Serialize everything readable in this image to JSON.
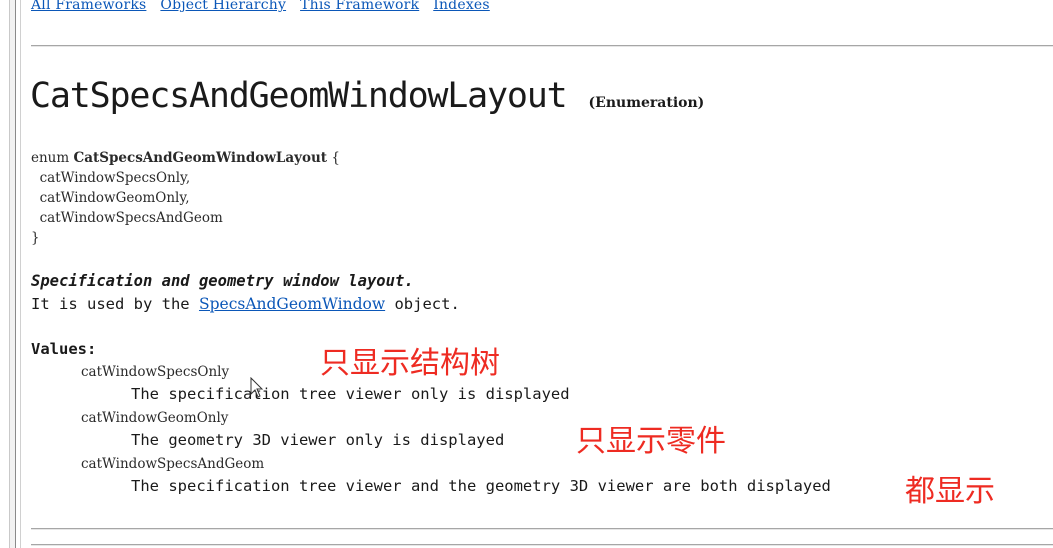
{
  "nav": {
    "links": [
      "All Frameworks",
      "Object Hierarchy",
      "This Framework",
      "Indexes"
    ]
  },
  "header": {
    "title": "CatSpecsAndGeomWindowLayout",
    "subtitle": "(Enumeration)"
  },
  "code": {
    "enum_keyword": "enum ",
    "enum_name": "CatSpecsAndGeomWindowLayout",
    "open_brace": " {",
    "lines": [
      "  catWindowSpecsOnly,",
      "  catWindowGeomOnly,",
      "  catWindowSpecsAndGeom"
    ],
    "close_brace": "}"
  },
  "description": {
    "headline": "Specification and geometry window layout.",
    "usage_prefix": "It is used by the ",
    "usage_link": "SpecsAndGeomWindow",
    "usage_suffix": " object."
  },
  "values": {
    "heading": "Values:",
    "items": [
      {
        "name": "catWindowSpecsOnly",
        "description": "The specification tree viewer only is displayed"
      },
      {
        "name": "catWindowGeomOnly",
        "description": "The geometry 3D viewer only is displayed"
      },
      {
        "name": "catWindowSpecsAndGeom",
        "description": "The specification tree viewer and the geometry 3D viewer are both displayed"
      }
    ]
  },
  "annotations": [
    "只显示结构树",
    "只显示零件",
    "都显示"
  ],
  "colors": {
    "link": "#0b57b8",
    "annotation": "#ee2b22",
    "rule": "#a6a6a6"
  },
  "icons": {
    "cursor": "mouse-pointer-icon"
  }
}
